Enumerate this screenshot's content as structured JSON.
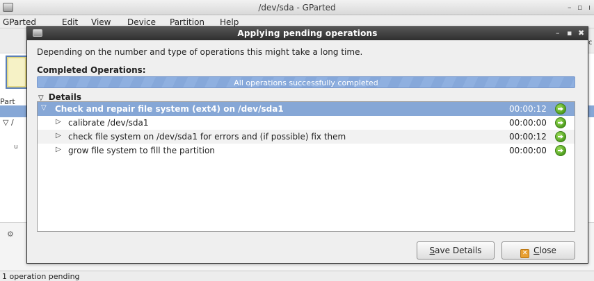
{
  "main_window": {
    "title": "/dev/sda - GParted",
    "menu": [
      "GParted",
      "Edit",
      "View",
      "Device",
      "Partition",
      "Help"
    ],
    "partition_label_fragment": "Part",
    "tree_row_fragment": "▽ /",
    "row_fragment": "u",
    "edge_fragment": "c",
    "statusbar_text": "1 operation pending"
  },
  "dialog": {
    "title": "Applying pending operations",
    "message": "Depending on the number and type of operations this might take a long time.",
    "completed_heading": "Completed Operations:",
    "progress_text": "All operations successfully completed",
    "progress_fraction": 1.0,
    "details_label": "Details",
    "operations": [
      {
        "label": "Check and repair file system (ext4) on /dev/sda1",
        "time": "00:00:12",
        "expanded": true,
        "level": 0,
        "status": "success-icon"
      },
      {
        "label": "calibrate /dev/sda1",
        "time": "00:00:00",
        "expanded": false,
        "level": 1,
        "status": "success-icon"
      },
      {
        "label": "check file system on /dev/sda1 for errors and (if possible) fix them",
        "time": "00:00:12",
        "expanded": false,
        "level": 1,
        "status": "success-icon"
      },
      {
        "label": "grow file system to fill the partition",
        "time": "00:00:00",
        "expanded": false,
        "level": 1,
        "status": "success-icon"
      }
    ],
    "buttons": {
      "save_mnemonic": "S",
      "save_rest": "ave Details",
      "close_mnemonic": "C",
      "close_rest": "lose"
    }
  },
  "colors": {
    "selection": "#86a7d6",
    "progress": "#8fb0e0",
    "titlebar_dark": "#3a3a3a",
    "success": "#4f9e1f"
  }
}
